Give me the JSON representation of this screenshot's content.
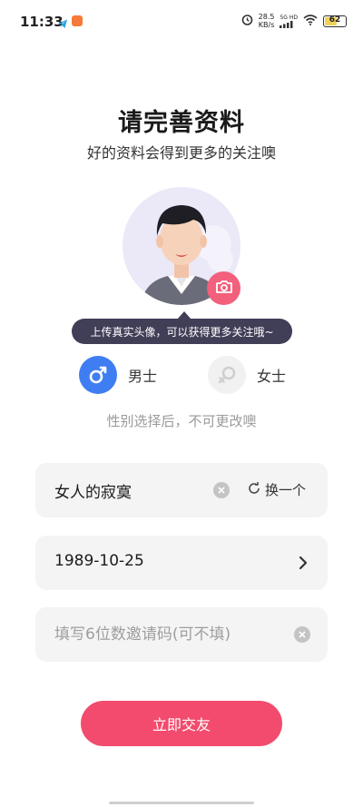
{
  "status_bar": {
    "time": "11:33",
    "net_speed_value": "28.5",
    "net_speed_unit": "KB/s",
    "signal_label": "5G HD",
    "battery_level": "62"
  },
  "header": {
    "title": "请完善资料",
    "subtitle": "好的资料会得到更多的关注噢"
  },
  "avatar": {
    "tooltip": "上传真实头像，可以获得更多关注哦~"
  },
  "gender": {
    "male_label": "男士",
    "female_label": "女士",
    "selected": "male",
    "note": "性别选择后，不可更改噢"
  },
  "form": {
    "nickname_value": "女人的寂寞",
    "swap_label": "换一个",
    "birthday_value": "1989-10-25",
    "invite_placeholder": "填写6位数邀请码(可不填)",
    "invite_value": ""
  },
  "submit": {
    "label": "立即交友"
  },
  "colors": {
    "accent": "#f24b6d",
    "camera": "#f2607c",
    "male_blue": "#3f7df2",
    "tooltip_bg": "#413e57",
    "field_bg": "#f4f4f4"
  }
}
